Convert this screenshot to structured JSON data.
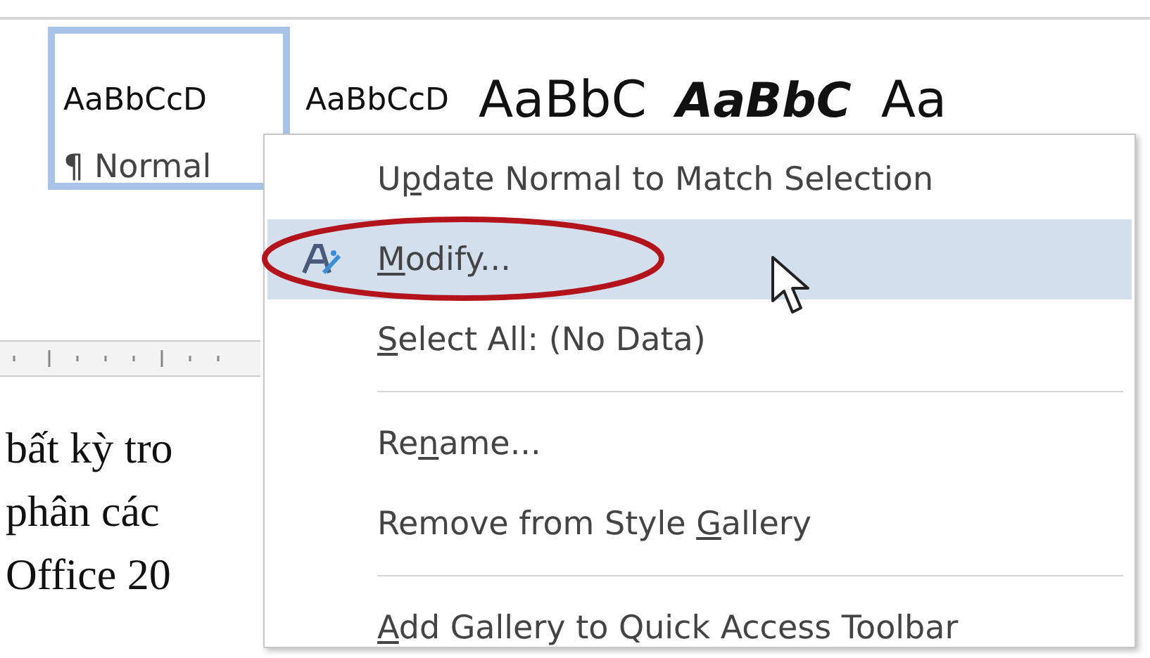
{
  "style_gallery": [
    {
      "sample": "AaBbCcD",
      "name": "¶ Normal",
      "kind": "plain",
      "selected": true
    },
    {
      "sample": "AaBbCcD",
      "kind": "plain",
      "selected": false
    },
    {
      "sample": "AaBbC",
      "kind": "large",
      "selected": false
    },
    {
      "sample": "AaBbC",
      "kind": "italic",
      "selected": false
    },
    {
      "sample": "Aa",
      "kind": "large",
      "selected": false
    }
  ],
  "document_lines": [
    "bất kỳ tro",
    "phân các",
    "Office 20"
  ],
  "context_menu": [
    {
      "kind": "item",
      "before": "U",
      "key": "p",
      "after": "date Normal to Match Selection",
      "has_icon": false,
      "selected": false
    },
    {
      "kind": "item",
      "key": "M",
      "after": "odify...",
      "has_icon": true,
      "selected": true,
      "circled": true
    },
    {
      "kind": "item",
      "key": "S",
      "after": "elect All: (No Data)",
      "has_icon": false,
      "selected": false
    },
    {
      "kind": "separator"
    },
    {
      "kind": "item",
      "before": "Re",
      "key": "n",
      "after": "ame...",
      "has_icon": false,
      "selected": false
    },
    {
      "kind": "item",
      "before": "Remove from Style ",
      "key": "G",
      "after": "allery",
      "has_icon": false,
      "selected": false
    },
    {
      "kind": "separator"
    },
    {
      "kind": "item",
      "key": "A",
      "after": "dd Gallery to Quick Access Toolbar",
      "has_icon": false,
      "selected": false
    }
  ]
}
